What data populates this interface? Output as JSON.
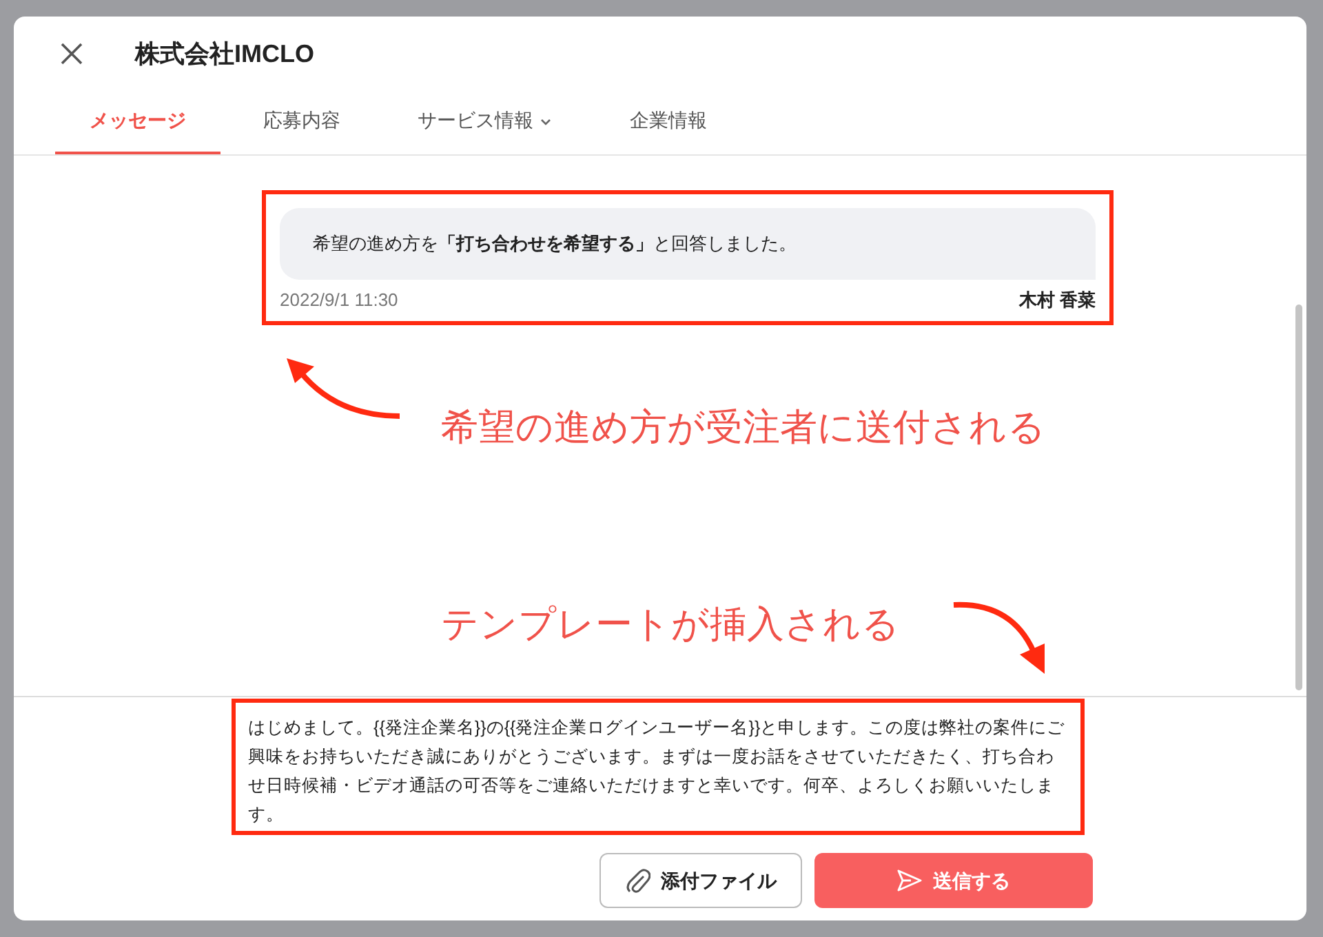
{
  "dialog": {
    "title": "株式会社IMCLO"
  },
  "tabs": [
    {
      "label": "メッセージ",
      "selected": true,
      "dropdown": false
    },
    {
      "label": "応募内容",
      "selected": false,
      "dropdown": false
    },
    {
      "label": "サービス情報",
      "selected": false,
      "dropdown": true
    },
    {
      "label": "企業情報",
      "selected": false,
      "dropdown": false
    }
  ],
  "message": {
    "text": "希望の進め方を**「打ち合わせを希望する」**と回答しました。",
    "time": "2022/9/1 11:30",
    "sender": "木村 香菜",
    "highlighted": true
  },
  "annotations": [
    "希望の進め方が受注者に送付される",
    "テンプレートが挿入される"
  ],
  "composer": {
    "value": "はじめまして。{{発注企業名}}の{{発注企業ログインユーザー名}}と申します。この度は弊社の案件にご興味をお持ちいただき誠にありがとうございます。まずは一度お話をさせていただきたく、打ち合わせ日時候補・ビデオ通話の可否等をご連絡いただけますと幸いです。何卒、よろしくお願いいたします。",
    "highlighted": true
  },
  "buttons": {
    "attach": "添付ファイル",
    "send": "送信する"
  }
}
